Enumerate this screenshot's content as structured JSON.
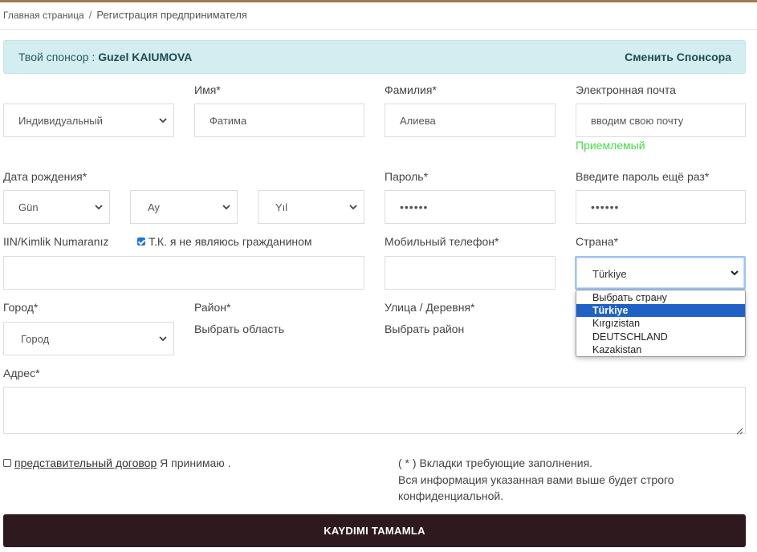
{
  "breadcrumb": {
    "home": "Главная страница",
    "separator": "/",
    "current": "Регистрация предпринимателя"
  },
  "sponsor": {
    "prefix": "Твой спонсор :",
    "name": "Guzel KAIUMOVA",
    "change_label": "Сменить Спонсора"
  },
  "form": {
    "type": {
      "value": "Индивидуальный"
    },
    "first_name": {
      "label": "Имя*",
      "value": "Фатима"
    },
    "last_name": {
      "label": "Фамилия*",
      "value": "Алиева"
    },
    "email": {
      "label": "Электронная почта",
      "value": "вводим свою почту",
      "status": "Приемлемый"
    },
    "birth_date": {
      "label": "Дата рождения*",
      "day": "Gün",
      "month": "Ay",
      "year": "Yıl"
    },
    "password": {
      "label": "Пароль*",
      "value": "••••••"
    },
    "password_repeat": {
      "label": "Введите пароль ещё раз*",
      "value": "••••••"
    },
    "iin": {
      "label": "IIN/Kimlik Numaranız",
      "not_citizen_label": "Т.К. я не являюсь гражданином",
      "not_citizen_checked": true
    },
    "mobile": {
      "label": "Мобильный телефон*"
    },
    "country": {
      "label": "Страна*",
      "selected": "Türkiye",
      "options": [
        "Выбрать страну",
        "Türkiye",
        "Kırgızistan",
        "DEUTSCHLAND",
        "Kazakistan"
      ],
      "highlighted_index": 1
    },
    "city": {
      "label": "Город*",
      "value": "Город"
    },
    "district": {
      "label": "Район*",
      "placeholder": "Выбрать область"
    },
    "street": {
      "label": "Улица / Деревня*",
      "placeholder": "Выбрать район"
    },
    "address": {
      "label": "Адрес*"
    },
    "agreement": {
      "link": "представительный договор",
      "suffix": " Я принимаю .",
      "checked": false
    },
    "notes": {
      "line1": "( * ) Вкладки требующие заполнения.",
      "line2": "Вся информация указанная вами выше будет строго",
      "line3": "конфиденциальной."
    },
    "submit_label": "KAYDIMI TAMAMLA"
  },
  "colors": {
    "accent_bar": "#a07a4e",
    "sponsor_bg": "#d3edf1",
    "ok_text": "#44dd44",
    "submit_bg": "#2e1a1e",
    "option_highlight": "#1f62c6"
  },
  "icons": {
    "chevron": "chevron-down-icon",
    "check": "checkbox-check-icon",
    "resize": "resize-grip-icon"
  }
}
